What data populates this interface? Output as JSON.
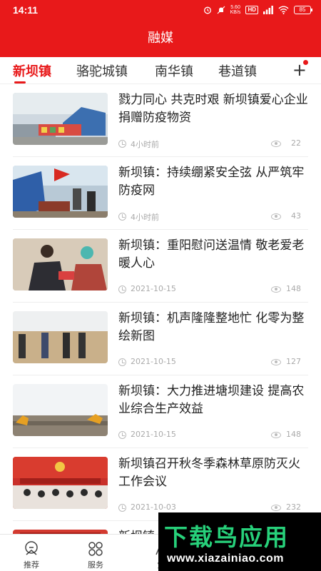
{
  "status_bar": {
    "time": "14:11",
    "net_speed": "5.60\nKB/s",
    "hd_badge": "HD",
    "battery": "85"
  },
  "header": {
    "title": "融媒"
  },
  "tabs": [
    {
      "label": "新坝镇",
      "active": true
    },
    {
      "label": "骆驼城镇",
      "active": false
    },
    {
      "label": "南华镇",
      "active": false
    },
    {
      "label": "巷道镇",
      "active": false
    }
  ],
  "add_tab_label": "+",
  "articles": [
    {
      "title": "戮力同心 共克时艰 新坝镇爱心企业捐赠防疫物资",
      "time": "4小时前",
      "views": "22"
    },
    {
      "title": "新坝镇：持续绷紧安全弦 从严筑牢防疫网",
      "time": "4小时前",
      "views": "43"
    },
    {
      "title": "新坝镇：重阳慰问送温情 敬老爱老暖人心",
      "time": "2021-10-15",
      "views": "148"
    },
    {
      "title": "新坝镇：机声隆隆整地忙 化零为整绘新图",
      "time": "2021-10-15",
      "views": "127"
    },
    {
      "title": "新坝镇：大力推进塘坝建设 提高农业综合生产效益",
      "time": "2021-10-15",
      "views": "148"
    },
    {
      "title": "新坝镇召开秋冬季森林草原防灭火工作会议",
      "time": "2021-10-03",
      "views": "232"
    },
    {
      "title": "新坝镇",
      "time": "",
      "views": ""
    }
  ],
  "bottom_nav": [
    {
      "label": "推荐",
      "icon": "recommend-icon"
    },
    {
      "label": "服务",
      "icon": "services-grid-icon"
    },
    {
      "label": "党",
      "icon": "party-icon"
    }
  ],
  "watermark": {
    "big": "下载鸟应用",
    "small": "www.xiazainiao.com"
  },
  "colors": {
    "brand_red": "#e8191a",
    "watermark_green": "#27d07a"
  }
}
